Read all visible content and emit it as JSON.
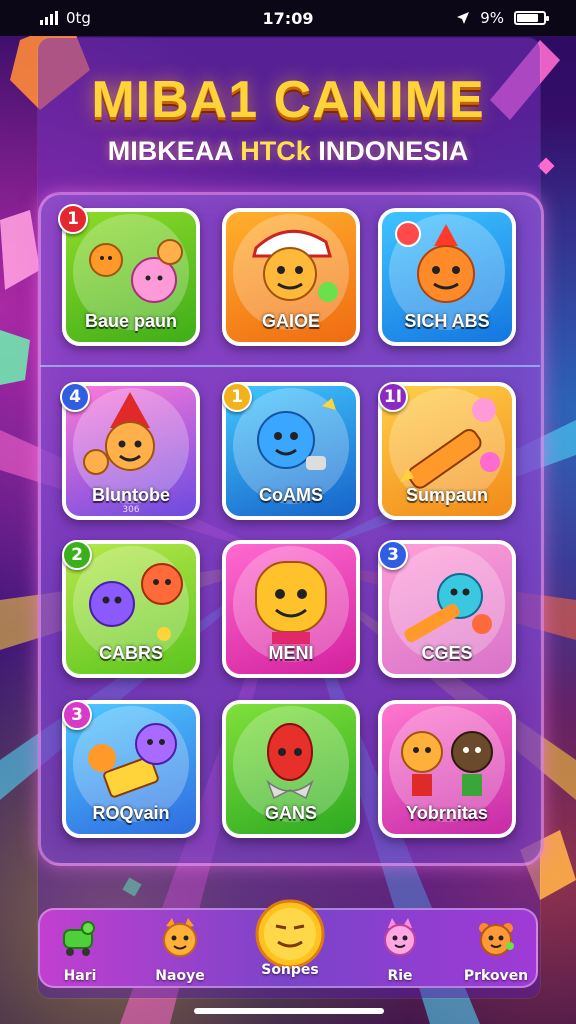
{
  "status_bar": {
    "carrier": "0tg",
    "time": "17:09",
    "battery": "9%",
    "location_icon": "location-arrow-icon"
  },
  "header": {
    "title": "MIBA1 CANIME",
    "subtitle_prefix": "MIBKEAA",
    "subtitle_highlight": "HTCk",
    "subtitle_suffix": "INDONESIA"
  },
  "tiles": [
    {
      "label": "Baue paun",
      "badge": "1",
      "badge_color": "#e4262f",
      "bg": [
        "#8edb2a",
        "#3fae19"
      ],
      "icon": "critter-group-icon"
    },
    {
      "label": "GAIOE",
      "badge": "",
      "badge_color": "",
      "bg": [
        "#ffb02c",
        "#f06b12"
      ],
      "icon": "capped-kid-icon"
    },
    {
      "label": "SICH ABS",
      "badge": "",
      "badge_color": "",
      "bg": [
        "#3fc4ff",
        "#1476e0"
      ],
      "icon": "fire-monster-icon"
    },
    {
      "label": "Bluntobe",
      "sublabel": "306",
      "badge": "4",
      "badge_color": "#2f5fe0",
      "bg": [
        "#ff7ad9",
        "#6b4ae0"
      ],
      "icon": "gnome-icon"
    },
    {
      "label": "CoAMS",
      "badge": "1",
      "badge_color": "#f2b21b",
      "bg": [
        "#41c7ff",
        "#1763c9"
      ],
      "icon": "blue-blob-icon"
    },
    {
      "label": "Sumpaun",
      "badge": "1I",
      "badge_color": "#8a2ac0",
      "bg": [
        "#ffcf48",
        "#f28a1a"
      ],
      "icon": "crayon-icon"
    },
    {
      "label": "CABRS",
      "badge": "2",
      "badge_color": "#3ab11b",
      "bg": [
        "#b6e84a",
        "#5cc51e"
      ],
      "icon": "purple-monster-icon"
    },
    {
      "label": "MENI",
      "badge": "",
      "badge_color": "",
      "bg": [
        "#ff6ad0",
        "#d3219e"
      ],
      "icon": "yellow-face-icon"
    },
    {
      "label": "CGES",
      "badge": "3",
      "badge_color": "#2f5fe0",
      "bg": [
        "#ff9fd8",
        "#d873c8"
      ],
      "icon": "pencil-buddy-icon"
    },
    {
      "label": "ROQvain",
      "badge": "3",
      "badge_color": "#d63ac6",
      "bg": [
        "#4fc8ff",
        "#2f6ce0"
      ],
      "icon": "ghost-cart-icon"
    },
    {
      "label": "GANS",
      "badge": "",
      "badge_color": "",
      "bg": [
        "#7fe03a",
        "#2eaa22"
      ],
      "icon": "red-squid-icon"
    },
    {
      "label": "Yobrnitas",
      "badge": "",
      "badge_color": "",
      "bg": [
        "#ff77cf",
        "#c72aa6"
      ],
      "icon": "two-friends-icon"
    }
  ],
  "bottom_nav": {
    "items": [
      {
        "label": "Hari",
        "icon": "green-cart-icon"
      },
      {
        "label": "Naoye",
        "icon": "orange-cat-icon"
      },
      {
        "label": "Sonpes",
        "icon": "emoji-face-icon"
      },
      {
        "label": "Rie",
        "icon": "pink-creature-icon"
      },
      {
        "label": "Prkoven",
        "icon": "orange-critter-icon"
      }
    ]
  },
  "colors": {
    "accent": "#ffd43a",
    "panel_border": "#ffa0f0",
    "nav_bg": "#a03ad6"
  }
}
